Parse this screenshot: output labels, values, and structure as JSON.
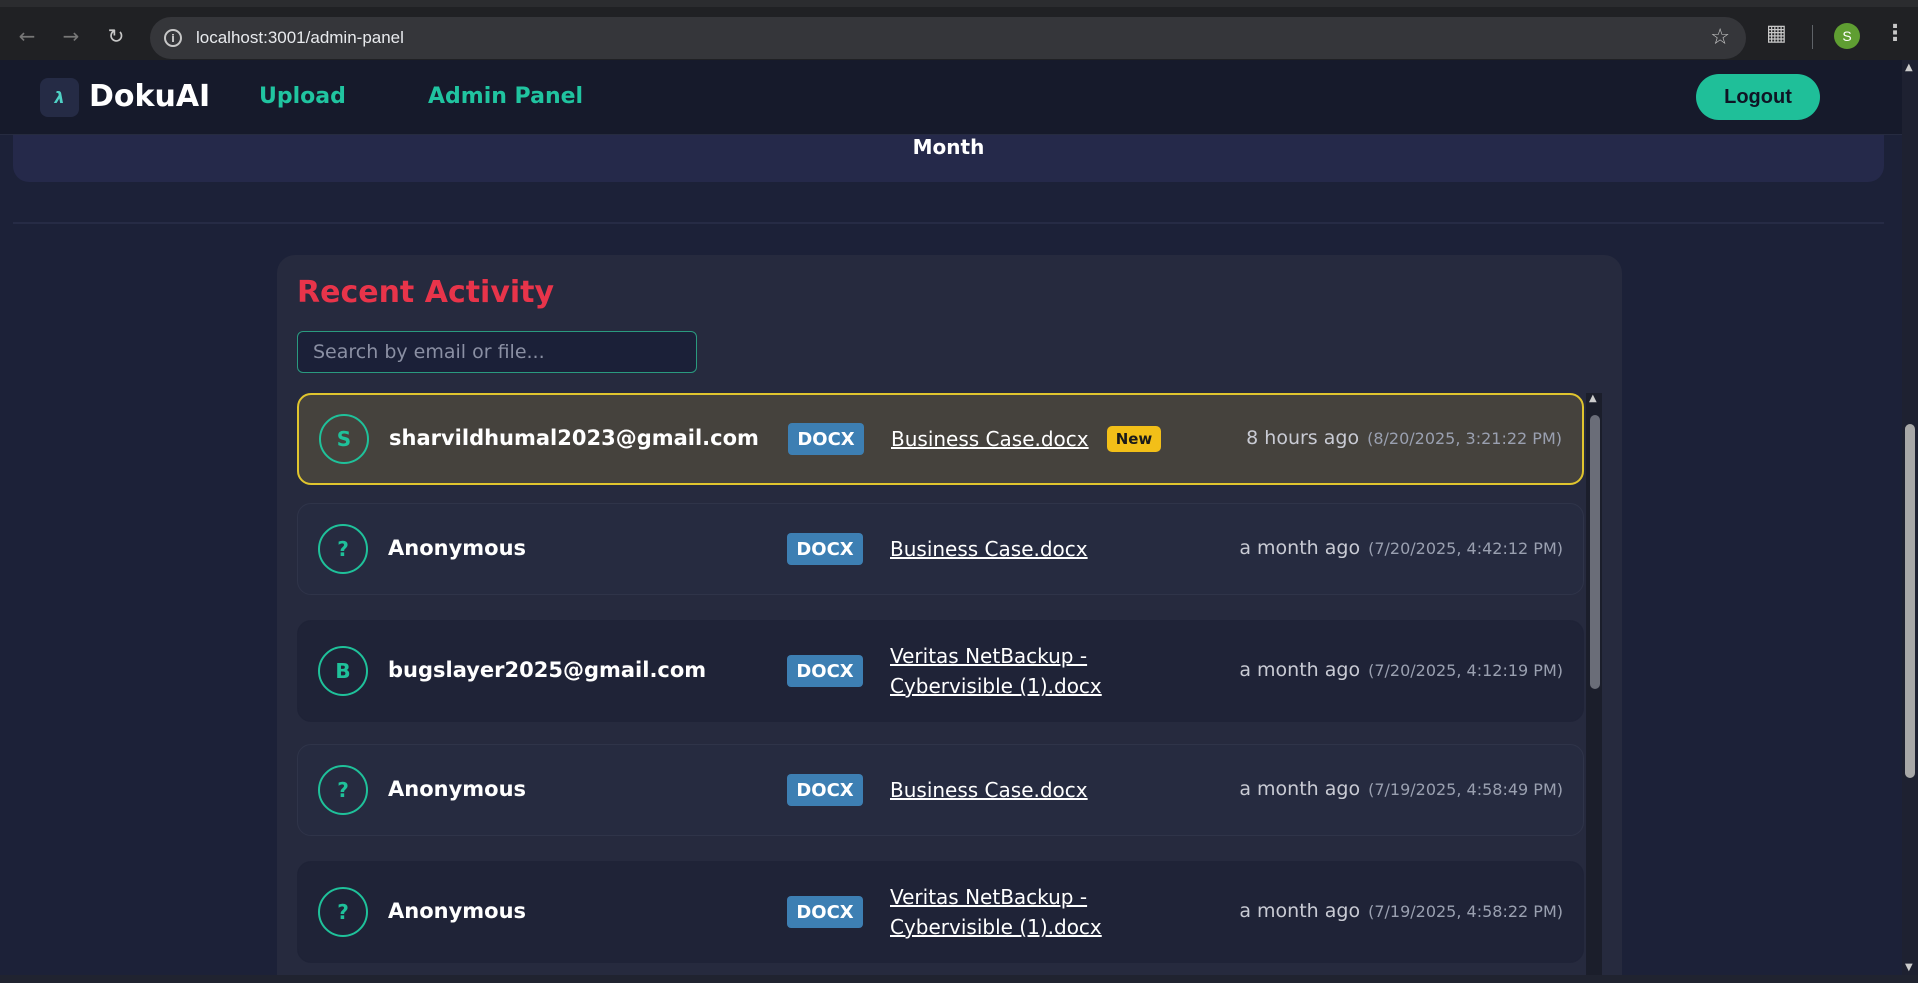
{
  "browser": {
    "url": "localhost:3001/admin-panel",
    "profile_initial": "S"
  },
  "header": {
    "brand": "DokuAI",
    "nav": {
      "upload": "Upload",
      "admin": "Admin Panel"
    },
    "logout_label": "Logout"
  },
  "stats": {
    "partial_label": "Month"
  },
  "activity": {
    "title": "Recent Activity",
    "search_placeholder": "Search by email or file...",
    "rows": [
      {
        "initial": "S",
        "user": "sharvildhumal2023@gmail.com",
        "type": "DOCX",
        "file_line1": "Business Case.docx",
        "file_line2": "",
        "is_new": true,
        "new_label": "New",
        "relative": "8 hours ago",
        "absolute": "(8/20/2025, 3:21:22 PM)"
      },
      {
        "initial": "?",
        "user": "Anonymous",
        "type": "DOCX",
        "file_line1": "Business Case.docx",
        "file_line2": "",
        "is_new": false,
        "relative": "a month ago",
        "absolute": "(7/20/2025, 4:42:12 PM)"
      },
      {
        "initial": "B",
        "user": "bugslayer2025@gmail.com",
        "type": "DOCX",
        "file_line1": "Veritas NetBackup -",
        "file_line2": "Cybervisible (1).docx",
        "is_new": false,
        "relative": "a month ago",
        "absolute": "(7/20/2025, 4:12:19 PM)"
      },
      {
        "initial": "?",
        "user": "Anonymous",
        "type": "DOCX",
        "file_line1": "Business Case.docx",
        "file_line2": "",
        "is_new": false,
        "relative": "a month ago",
        "absolute": "(7/19/2025, 4:58:49 PM)"
      },
      {
        "initial": "?",
        "user": "Anonymous",
        "type": "DOCX",
        "file_line1": "Veritas NetBackup -",
        "file_line2": "Cybervisible (1).docx",
        "is_new": false,
        "relative": "a month ago",
        "absolute": "(7/19/2025, 4:58:22 PM)"
      }
    ]
  },
  "colors": {
    "accent": "#1fbf99",
    "title_red": "#e8344a",
    "highlight_border": "#e0c52e",
    "docx_badge": "#3d7fb3"
  }
}
